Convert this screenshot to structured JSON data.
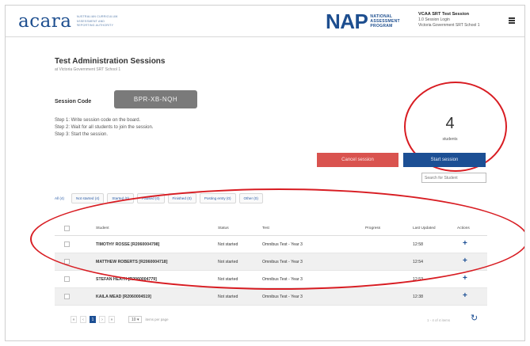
{
  "header": {
    "brand": "acara",
    "brand_tagline": [
      "AUSTRALIAN CURRICULUM,",
      "ASSESSMENT AND",
      "REPORTING AUTHORITY"
    ],
    "nap_brand": "NAP",
    "nap_tagline": [
      "NATIONAL",
      "ASSESSMENT",
      "PROGRAM"
    ],
    "session_name": "VCAA SRT Test Session",
    "session_level": "1.0 Session Login",
    "session_school": "Victoria Government SRT School 1",
    "menu_icon": "hamburger-menu-icon"
  },
  "page": {
    "title": "Test Administration Sessions",
    "subtitle": "at Victoria Government SRT School 1",
    "session_code_label": "Session Code",
    "session_code_value": "BPR-XB-NQH",
    "steps": [
      "Step 1: Write session code on the board.",
      "Step 2: Wait for all students to join the session.",
      "Step 3: Start the session."
    ],
    "student_count": "4",
    "student_count_label": "students",
    "cancel_label": "Cancel session",
    "start_label": "Start session",
    "search_placeholder": "Search for Student"
  },
  "filters": [
    "All (4)",
    "Not started (4)",
    "Started (0)",
    "Paused (0)",
    "Finished (0)",
    "Posting entry (0)",
    "Other (0)"
  ],
  "table": {
    "columns": [
      "Student",
      "Status",
      "Test",
      "Progress",
      "Last Updated",
      "Actions"
    ],
    "rows": [
      {
        "name": "TIMOTHY ROSSE [R2060004798]",
        "status": "Not started",
        "test": "Omnibus Test - Year 3",
        "progress": "",
        "updated": "12:58"
      },
      {
        "name": "MATTHEW ROBERTS [R2060004718]",
        "status": "Not started",
        "test": "Omnibus Test - Year 3",
        "progress": "",
        "updated": "12:54"
      },
      {
        "name": "STEFAN HEATH [R2060004779]",
        "status": "Not started",
        "test": "Omnibus Test - Year 3",
        "progress": "",
        "updated": "12:53"
      },
      {
        "name": "KAILA MEAD [R2060004519]",
        "status": "Not started",
        "test": "Omnibus Test - Year 3",
        "progress": "",
        "updated": "12:38"
      }
    ]
  },
  "pagination": {
    "first": "«",
    "prev": "‹",
    "current": "1",
    "next": "›",
    "last": "»",
    "per_page": "10",
    "per_page_text": "items per page",
    "range": "1 - 4 of 4 items"
  },
  "colors": {
    "brand_blue": "#1c4f94",
    "cancel_red": "#d9534f",
    "annotation_red": "#d81c22"
  }
}
